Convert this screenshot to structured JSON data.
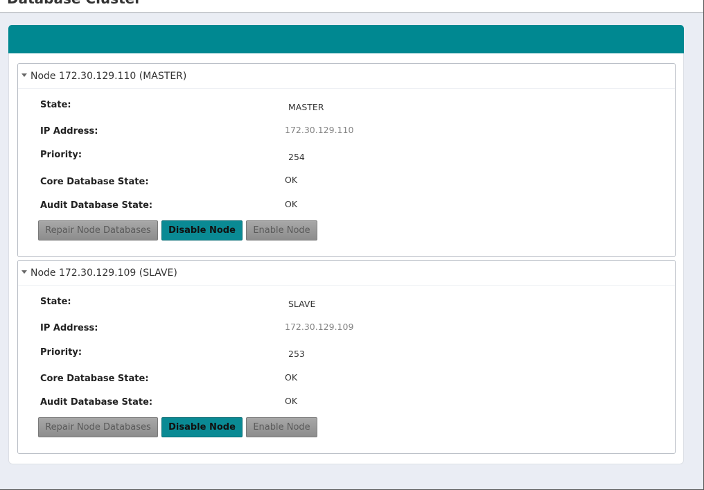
{
  "page": {
    "title": "Database Cluster"
  },
  "labels": {
    "state": "State:",
    "ip_address": "IP Address:",
    "priority": "Priority:",
    "core_db_state": "Core Database State:",
    "audit_db_state": "Audit Database State:"
  },
  "buttons": {
    "repair": "Repair Node Databases",
    "disable": "Disable Node",
    "enable": "Enable Node"
  },
  "nodes": [
    {
      "title": "Node 172.30.129.110 (MASTER)",
      "state": "MASTER",
      "ip": "172.30.129.110",
      "priority": "254",
      "core_state": "OK",
      "audit_state": "OK"
    },
    {
      "title": "Node 172.30.129.109 (SLAVE)",
      "state": "SLAVE",
      "ip": "172.30.129.109",
      "priority": "253",
      "core_state": "OK",
      "audit_state": "OK"
    }
  ],
  "colors": {
    "accent": "#008891",
    "button_teal": "#0a8a94",
    "background": "#eaedf4"
  }
}
